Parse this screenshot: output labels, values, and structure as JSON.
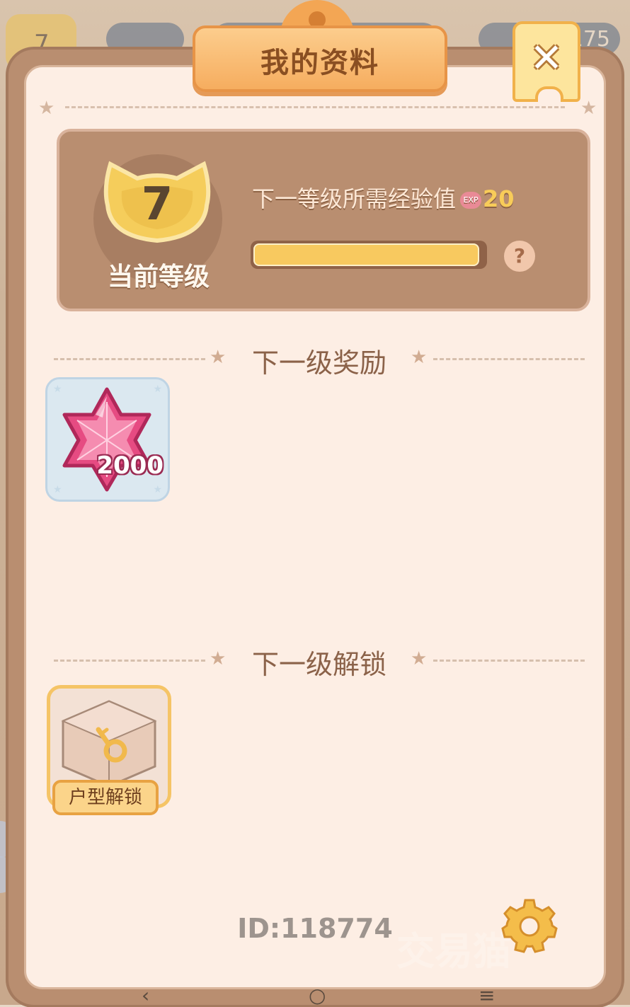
{
  "background": {
    "level": "7",
    "currency_value": "175"
  },
  "dialog": {
    "title": "我的资料",
    "close_label": "✕"
  },
  "level_card": {
    "level": "7",
    "level_caption": "当前等级",
    "exp_label": "下一等级所需经验值",
    "exp_icon_text": "EXP",
    "exp_needed": "20",
    "progress_fraction": 0.98,
    "help_label": "?"
  },
  "reward_section": {
    "title": "下一级奖励",
    "items": [
      {
        "icon": "pink-gem-icon",
        "amount": "2000"
      }
    ]
  },
  "unlock_section": {
    "title": "下一级解锁",
    "items": [
      {
        "icon": "room-key-icon",
        "label": "户型解锁"
      }
    ]
  },
  "footer": {
    "player_id": "ID:118774",
    "watermark": "交易猫"
  },
  "system_nav": {
    "back": "‹",
    "home": "○",
    "menu": "≡"
  },
  "colors": {
    "panel_brown": "#b98e70",
    "panel_cream": "#fdeee4",
    "title_orange": "#f6ad5f",
    "progress_yellow": "#f8c95f",
    "gem_pink": "#e0407a"
  }
}
